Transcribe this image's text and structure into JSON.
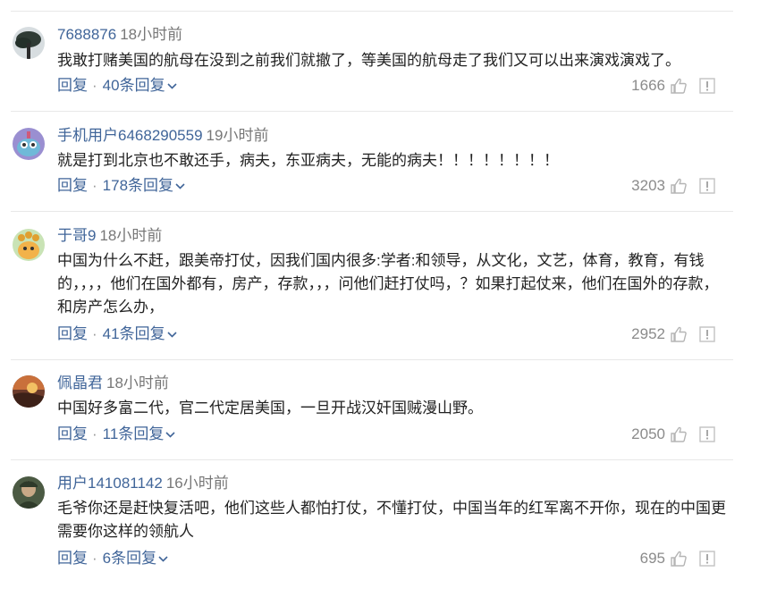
{
  "comments": [
    {
      "user": "7688876",
      "time": "18小时前",
      "text": "我敢打赌美国的航母在没到之前我们就撤了，等美国的航母走了我们又可以出来演戏演戏了。",
      "reply_label": "回复",
      "replies": "40条回复",
      "likes": "1666",
      "avatar_icon": "tree-avatar"
    },
    {
      "user": "手机用户6468290559",
      "time": "19小时前",
      "text": "就是打到北京也不敢还手，病夫，东亚病夫，无能的病夫！！！！！！！！",
      "reply_label": "回复",
      "replies": "178条回复",
      "likes": "3203",
      "avatar_icon": "cartoon-monster-avatar"
    },
    {
      "user": "于哥9",
      "time": "18小时前",
      "text": "中国为什么不赶，跟美帝打仗，因我们国内很多:学者:和领导，从文化，文艺，体育，教育，有钱的，，，，他们在国外都有，房产，存款，，，问他们赶打仗吗，？如果打起仗来，他们在国外的存款，和房产怎么办，",
      "reply_label": "回复",
      "replies": "41条回复",
      "likes": "2952",
      "avatar_icon": "cartoon-creature-avatar"
    },
    {
      "user": "佩晶君",
      "time": "18小时前",
      "text": "中国好多富二代，官二代定居美国，一旦开战汉奸国贼漫山野。",
      "reply_label": "回复",
      "replies": "11条回复",
      "likes": "2050",
      "avatar_icon": "sunset-avatar"
    },
    {
      "user": "用户141081142",
      "time": "16小时前",
      "text": "毛爷你还是赶快复活吧，他们这些人都怕打仗，不懂打仗，中国当年的红军离不开你，现在的中国更需要你这样的领航人",
      "reply_label": "回复",
      "replies": "6条回复",
      "likes": "695",
      "avatar_icon": "soldier-avatar"
    }
  ],
  "colors": {
    "username": "#406599",
    "text": "#222222",
    "meta": "#777777",
    "divider": "#e8e8e8"
  }
}
